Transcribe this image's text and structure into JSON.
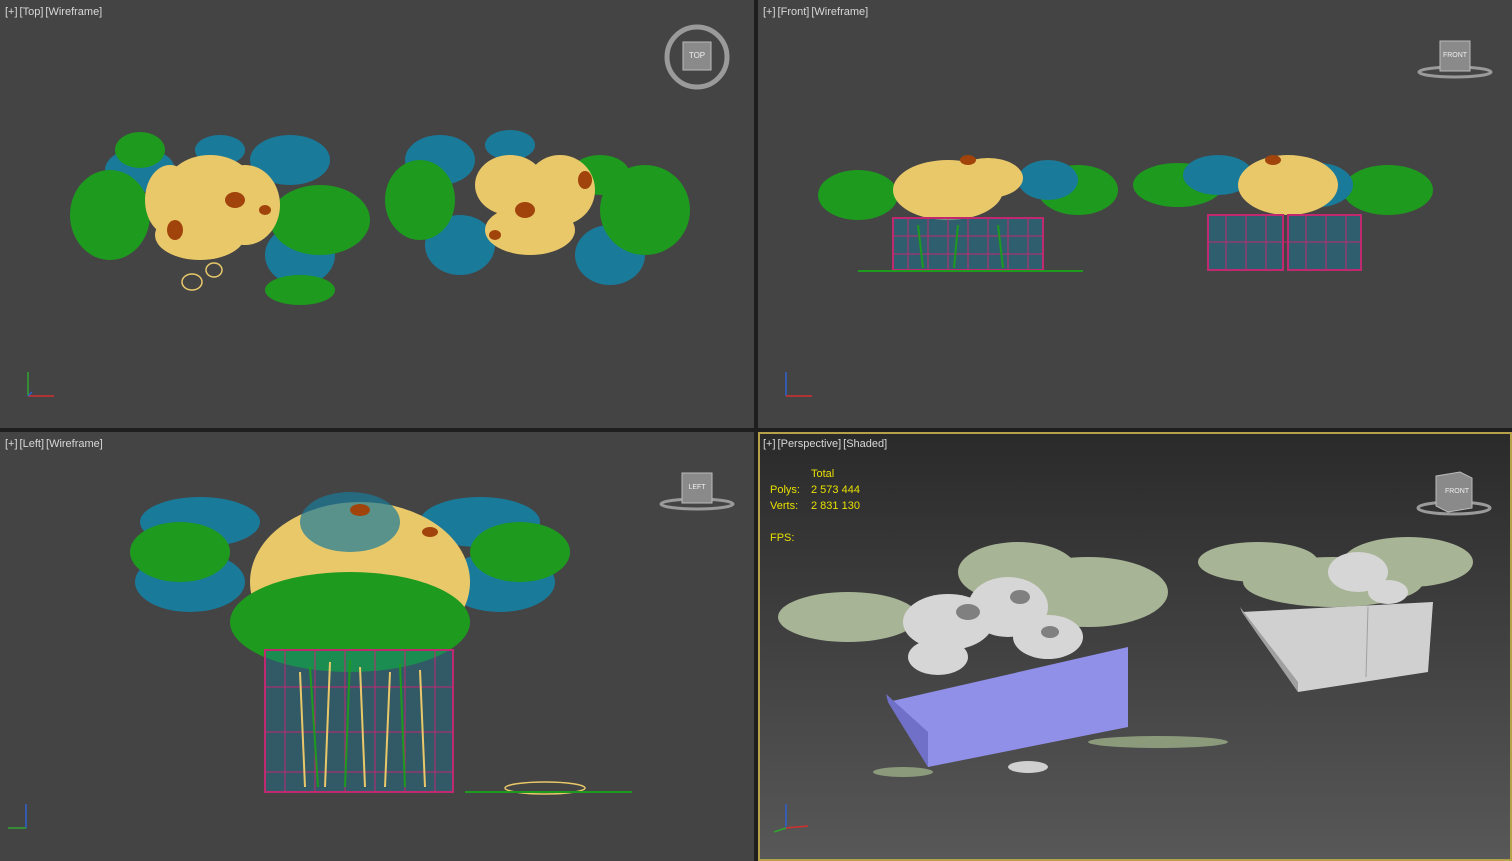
{
  "viewports": {
    "top": {
      "plus": "[+]",
      "name": "[Top]",
      "mode": "[Wireframe]",
      "cube_label": "TOP",
      "axes": [
        "y",
        "x"
      ]
    },
    "front": {
      "plus": "[+]",
      "name": "[Front]",
      "mode": "[Wireframe]",
      "cube_label": "FRONT",
      "axes": [
        "z",
        "x"
      ]
    },
    "left": {
      "plus": "[+]",
      "name": "[Left]",
      "mode": "[Wireframe]",
      "cube_label": "LEFT",
      "axes": [
        "z",
        "y"
      ]
    },
    "perspective": {
      "plus": "[+]",
      "name": "[Perspective]",
      "mode": "[Shaded]",
      "cube_label": "FRONT",
      "axes": [
        "z",
        "x"
      ]
    }
  },
  "stats": {
    "header": "Total",
    "polys_label": "Polys:",
    "polys_value": "2 573 444",
    "verts_label": "Verts:",
    "verts_value": "2 831 130",
    "fps_label": "FPS:"
  },
  "colors": {
    "viewport_bg": "#444444",
    "active_border": "#b8a04a",
    "wire_green": "#1e9a1e",
    "wire_blue": "#1a7a9a",
    "wire_yellow": "#e9c86a",
    "wire_brown": "#a0440c",
    "wire_magenta": "#c02870",
    "stats_text": "#e8e000"
  }
}
